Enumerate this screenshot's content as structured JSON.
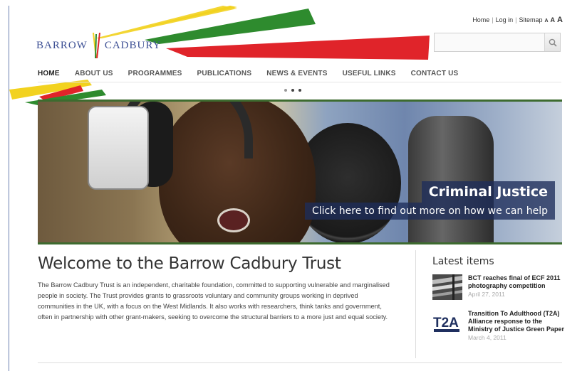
{
  "brand": {
    "left": "BARROW",
    "right": "CADBURY"
  },
  "toplinks": {
    "home": "Home",
    "login": "Log in",
    "sitemap": "Sitemap",
    "a_small": "A",
    "a_medium": "A",
    "a_large": "A",
    "sep": "|"
  },
  "search": {
    "placeholder": ""
  },
  "nav": [
    "HOME",
    "ABOUT US",
    "PROGRAMMES",
    "PUBLICATIONS",
    "NEWS & EVENTS",
    "USEFUL LINKS",
    "CONTACT US"
  ],
  "banner": {
    "title": "Criminal Justice",
    "subtitle": "Click here to find out more on how we can help"
  },
  "welcome": {
    "title": "Welcome to the Barrow Cadbury Trust",
    "body": "The Barrow Cadbury Trust is an independent, charitable foundation, committed to supporting vulnerable and marginalised people in society. The Trust provides grants to grassroots voluntary and community groups working in deprived communities in the UK, with a focus on the West Midlands. It also works with researchers, think tanks and government, often in partnership with other grant-makers, seeking to overcome the structural barriers to a more just and equal society."
  },
  "latest": {
    "heading": "Latest items",
    "items": [
      {
        "title": "BCT reaches final of ECF 2011 photography competition",
        "date": "April 27, 2011"
      },
      {
        "title": "Transition To Adulthood (T2A) Alliance response to the Ministry of Justice Green Paper",
        "date": "March 4, 2011"
      }
    ],
    "t2a_logo": "T2A"
  },
  "colors": {
    "brand_blue": "#3c4f94",
    "stripe_yellow": "#f2d21f",
    "stripe_green": "#2e8b2e",
    "stripe_red": "#e0242a",
    "banner_border": "#3d6b2f"
  }
}
